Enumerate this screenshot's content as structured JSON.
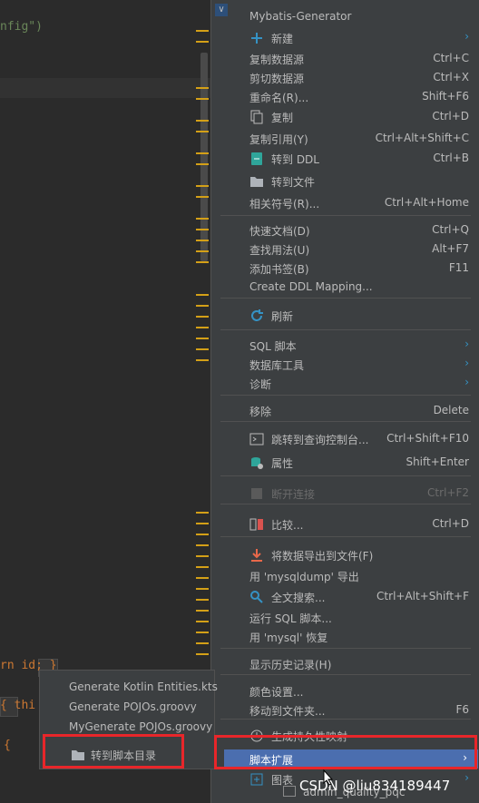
{
  "editor": {
    "lines": [
      {
        "id": "l1",
        "text": "nfig\")"
      },
      {
        "id": "l2",
        "text": "rn id; }"
      },
      {
        "id": "l3",
        "text": "{ thi"
      },
      {
        "id": "l4",
        "text": "{"
      }
    ]
  },
  "menu": {
    "header": "Mybatis-Generator",
    "items": [
      {
        "label": "新建",
        "shortcut": "",
        "arrow": true,
        "icon": "plus-icon"
      },
      {
        "label": "复制数据源",
        "shortcut": "Ctrl+C"
      },
      {
        "label": "剪切数据源",
        "shortcut": "Ctrl+X"
      },
      {
        "label": "重命名(R)...",
        "shortcut": "Shift+F6"
      },
      {
        "label": "复制",
        "shortcut": "Ctrl+D",
        "icon": "copy-icon"
      },
      {
        "label": "复制引用(Y)",
        "shortcut": "Ctrl+Alt+Shift+C"
      },
      {
        "label": "转到 DDL",
        "shortcut": "Ctrl+B",
        "icon": "ddl-icon"
      },
      {
        "label": "转到文件",
        "shortcut": "",
        "icon": "folder-icon"
      },
      {
        "label": "相关符号(R)...",
        "shortcut": "Ctrl+Alt+Home"
      },
      {
        "label": "快速文档(D)",
        "shortcut": "Ctrl+Q"
      },
      {
        "label": "查找用法(U)",
        "shortcut": "Alt+F7"
      },
      {
        "label": "添加书签(B)",
        "shortcut": "F11"
      },
      {
        "label": "Create DDL Mapping...",
        "shortcut": ""
      },
      {
        "label": "刷新",
        "shortcut": "",
        "icon": "refresh-icon"
      },
      {
        "label": "SQL 脚本",
        "arrow": true
      },
      {
        "label": "数据库工具",
        "arrow": true
      },
      {
        "label": "诊断",
        "arrow": true
      },
      {
        "label": "移除",
        "shortcut": "Delete"
      },
      {
        "label": "跳转到查询控制台...",
        "shortcut": "Ctrl+Shift+F10",
        "icon": "console-icon"
      },
      {
        "label": "属性",
        "shortcut": "Shift+Enter",
        "icon": "properties-icon"
      },
      {
        "label": "断开连接",
        "shortcut": "Ctrl+F2",
        "icon": "disconnect-icon",
        "disabled": true
      },
      {
        "label": "比较...",
        "shortcut": "Ctrl+D",
        "icon": "compare-icon"
      },
      {
        "label": "将数据导出到文件(F)",
        "shortcut": "",
        "icon": "export-icon"
      },
      {
        "label": "用 'mysqldump' 导出",
        "shortcut": ""
      },
      {
        "label": "全文搜索...",
        "shortcut": "Ctrl+Alt+Shift+F",
        "icon": "search-icon"
      },
      {
        "label": "运行 SQL 脚本...",
        "shortcut": ""
      },
      {
        "label": "用 'mysql' 恢复",
        "shortcut": ""
      },
      {
        "label": "显示历史记录(H)",
        "shortcut": ""
      },
      {
        "label": "颜色设置...",
        "shortcut": ""
      },
      {
        "label": "移动到文件夹...",
        "shortcut": "F6"
      },
      {
        "label": "生成持久性映射",
        "shortcut": "",
        "icon": "clock-icon"
      },
      {
        "label": "脚本扩展",
        "arrow": true,
        "active": true
      },
      {
        "label": "图表",
        "arrow": true,
        "icon": "diagram-icon"
      }
    ]
  },
  "submenu": {
    "items": [
      {
        "label": "Generate Kotlin Entities.kts"
      },
      {
        "label": "Generate POJOs.groovy"
      },
      {
        "label": "MyGenerate POJOs.groovy"
      },
      {
        "label": "转到脚本目录",
        "icon": "folder-icon"
      }
    ]
  },
  "bottom_tree": {
    "label": "admin_quality_pqc"
  },
  "watermark": "CSDN @liu834189447"
}
